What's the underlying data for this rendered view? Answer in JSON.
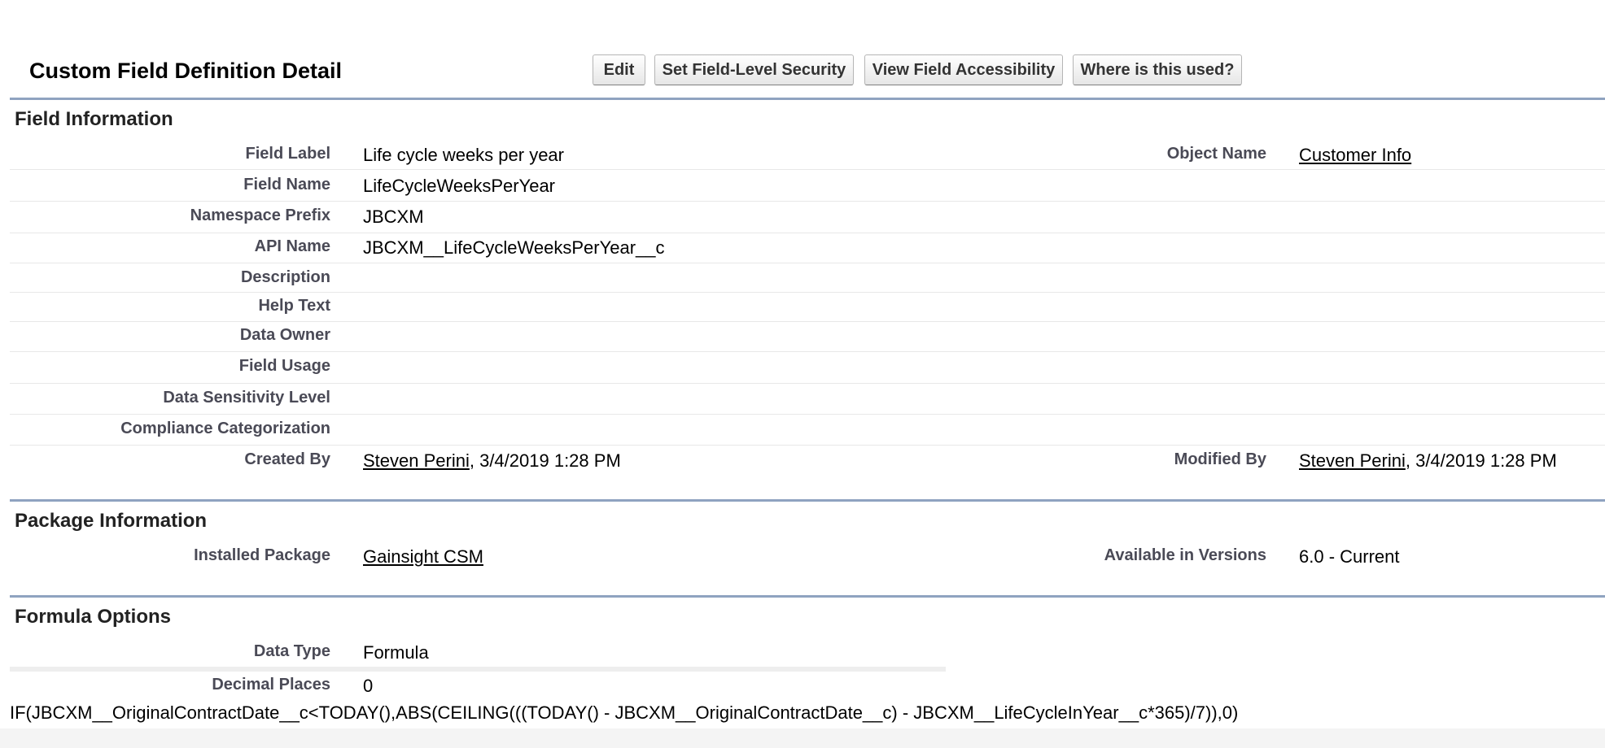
{
  "page": {
    "title": "Custom Field Definition Detail"
  },
  "buttons": {
    "edit": "Edit",
    "set_fls": "Set Field-Level Security",
    "view_accessibility": "View Field Accessibility",
    "where_used": "Where is this used?"
  },
  "field_information": {
    "heading": "Field Information",
    "rows": [
      {
        "label": "Field Label",
        "value": "Life cycle weeks per year"
      },
      {
        "label": "Field Name",
        "value": "LifeCycleWeeksPerYear"
      },
      {
        "label": "Namespace Prefix",
        "value": "JBCXM"
      },
      {
        "label": "API Name",
        "value": "JBCXM__LifeCycleWeeksPerYear__c"
      },
      {
        "label": "Description",
        "value": ""
      },
      {
        "label": "Help Text",
        "value": ""
      },
      {
        "label": "Data Owner",
        "value": ""
      },
      {
        "label": "Field Usage",
        "value": ""
      },
      {
        "label": "Data Sensitivity Level",
        "value": ""
      },
      {
        "label": "Compliance Categorization",
        "value": ""
      }
    ],
    "object_name_label": "Object Name",
    "object_name_value": "Customer Info",
    "created_by_label": "Created By",
    "created_by_user": "Steven Perini",
    "created_by_date": ", 3/4/2019 1:28 PM",
    "modified_by_label": "Modified By",
    "modified_by_user": "Steven Perini",
    "modified_by_date": ", 3/4/2019 1:28 PM"
  },
  "package_information": {
    "heading": "Package Information",
    "installed_package_label": "Installed Package",
    "installed_package_value": "Gainsight CSM",
    "available_versions_label": "Available in Versions",
    "available_versions_value": "6.0 - Current"
  },
  "formula_options": {
    "heading": "Formula Options",
    "data_type_label": "Data Type",
    "data_type_value": "Formula",
    "decimal_places_label": "Decimal Places",
    "decimal_places_value": "0",
    "formula": "IF(JBCXM__OriginalContractDate__c<TODAY(),ABS(CEILING(((TODAY() - JBCXM__OriginalContractDate__c) - JBCXM__LifeCycleInYear__c*365)/7)),0)"
  }
}
